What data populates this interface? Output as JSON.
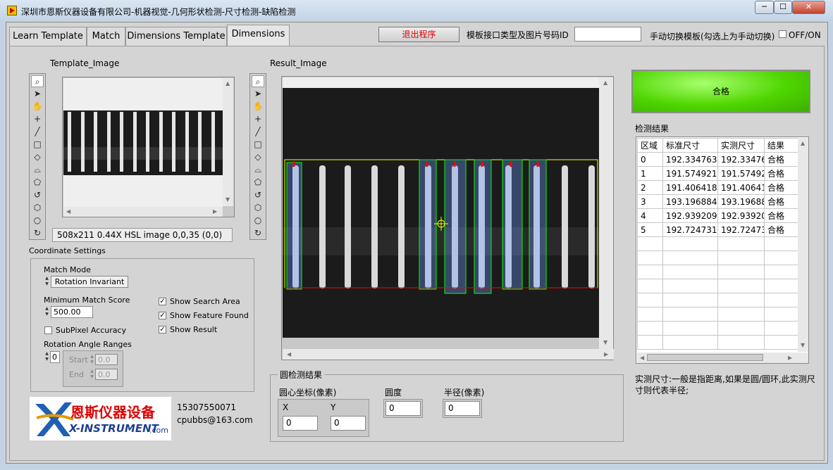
{
  "window": {
    "title": "深圳市恩斯仪器设备有限公司-机器视觉-几何形状检测-尺寸检测-缺陷检测",
    "min": "─",
    "max": "☐",
    "close": "✕"
  },
  "tabs": [
    {
      "label": "Learn Template"
    },
    {
      "label": "Match"
    },
    {
      "label": "Dimensions Template"
    },
    {
      "label": "Dimensions"
    }
  ],
  "header": {
    "exit_label": "退出程序",
    "template_id_label": "模板接口类型及图片号码ID",
    "template_id_value": "",
    "manual_switch_label": "手动切换模板(勾选上为手动切换)",
    "manual_switch_text": "OFF/ON"
  },
  "template_image": {
    "label": "Template_Image",
    "status": "508x211 0.44X HSL image 0,0,35    (0,0)"
  },
  "coordinate_settings": {
    "label": "Coordinate Settings",
    "match_mode_label": "Match Mode",
    "match_mode_value": "Rotation Invariant",
    "min_score_label": "Minimum Match Score",
    "min_score_value": "500.00",
    "subpixel_label": "SubPixel Accuracy",
    "rotation_label": "Rotation Angle Ranges",
    "rotation_index": "0",
    "start_label": "Start",
    "start_value": "0.0",
    "end_label": "End",
    "end_value": "0.0",
    "show_search_area": "Show Search Area",
    "show_feature_found": "Show Feature Found",
    "show_result": "Show Result"
  },
  "result_image": {
    "label": "Result_Image"
  },
  "pass_indicator": {
    "label": "合格",
    "color": "#4fd600"
  },
  "results": {
    "label": "检测结果",
    "columns": [
      "区域",
      "标准尺寸",
      "实测尺寸",
      "结果"
    ],
    "rows": [
      [
        "0",
        "192.334763",
        "192.33476",
        "合格"
      ],
      [
        "1",
        "191.574921",
        "191.57492",
        "合格"
      ],
      [
        "2",
        "191.406418",
        "191.40641",
        "合格"
      ],
      [
        "3",
        "193.196884",
        "193.19688",
        "合格"
      ],
      [
        "4",
        "192.939209",
        "192.93920",
        "合格"
      ],
      [
        "5",
        "192.724731",
        "192.72473",
        "合格"
      ]
    ]
  },
  "note": "实测尺寸:一般是指距离,如果是圆/圆环,此实测尺寸则代表半径;",
  "circle_detection": {
    "label": "圆检测结果",
    "center_label": "圆心坐标(像素)",
    "x_label": "X",
    "y_label": "Y",
    "x_value": "0",
    "y_value": "0",
    "roundness_label": "圆度",
    "roundness_value": "0",
    "radius_label": "半径(像素)",
    "radius_value": "0"
  },
  "company": {
    "logo_cn": "恩斯仪器设备",
    "logo_en": "X-INSTRUMENT",
    "logo_suffix": ".com",
    "phone": "15307550071",
    "email": "cpubbs@163.com"
  },
  "tools": [
    "zoom-icon",
    "pointer-icon",
    "pan-hand-icon",
    "point-icon",
    "line-icon",
    "rectangle-icon",
    "rotated-rect-icon",
    "annulus-icon",
    "polygon-icon",
    "freehand-icon",
    "broken-line-icon",
    "oval-icon",
    "rotate-icon"
  ]
}
